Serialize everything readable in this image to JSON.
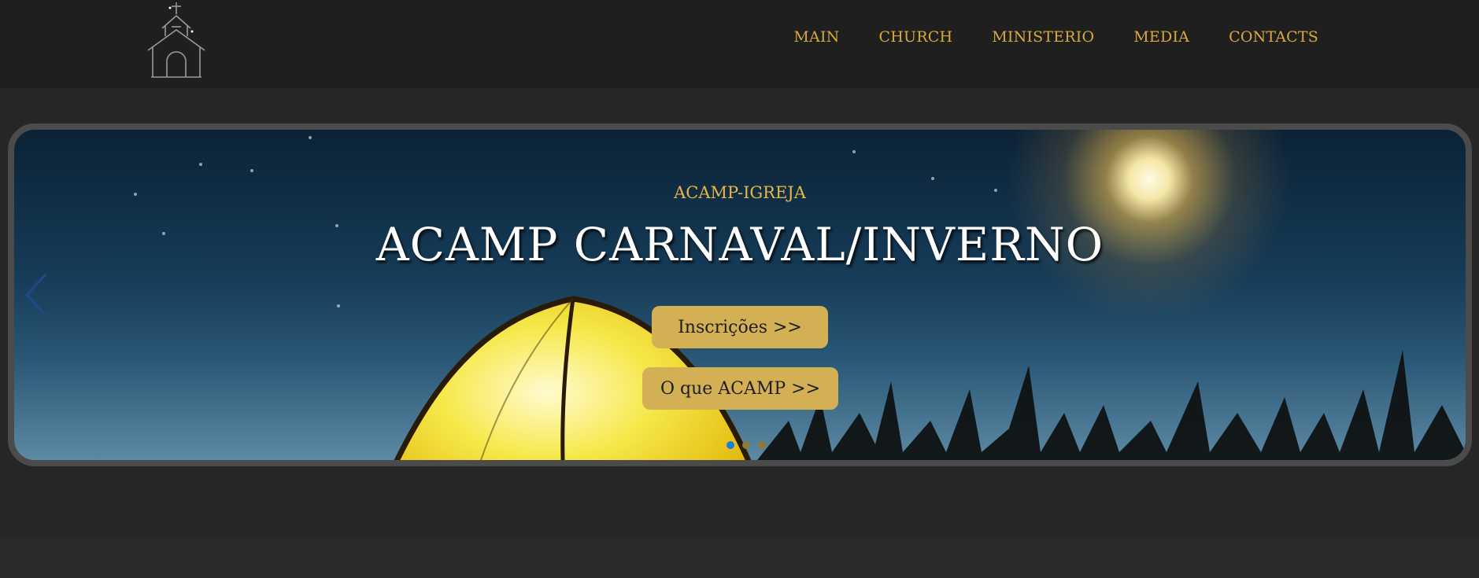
{
  "nav": {
    "items": [
      {
        "label": "MAIN"
      },
      {
        "label": "CHURCH"
      },
      {
        "label": "MINISTERIO"
      },
      {
        "label": "MEDIA"
      },
      {
        "label": "CONTACTS"
      }
    ]
  },
  "hero": {
    "subtitle": "ACAMP-IGREJA",
    "title": "ACAMP CARNAVAL/INVERNO",
    "buttons": [
      {
        "label": "Inscrições >>"
      },
      {
        "label": "O que ACAMP >>"
      }
    ],
    "slides_total": 3,
    "active_slide": 1
  },
  "colors": {
    "accent": "#d8aa3c",
    "button": "#d4b055",
    "active_dot": "#1c7be0"
  }
}
